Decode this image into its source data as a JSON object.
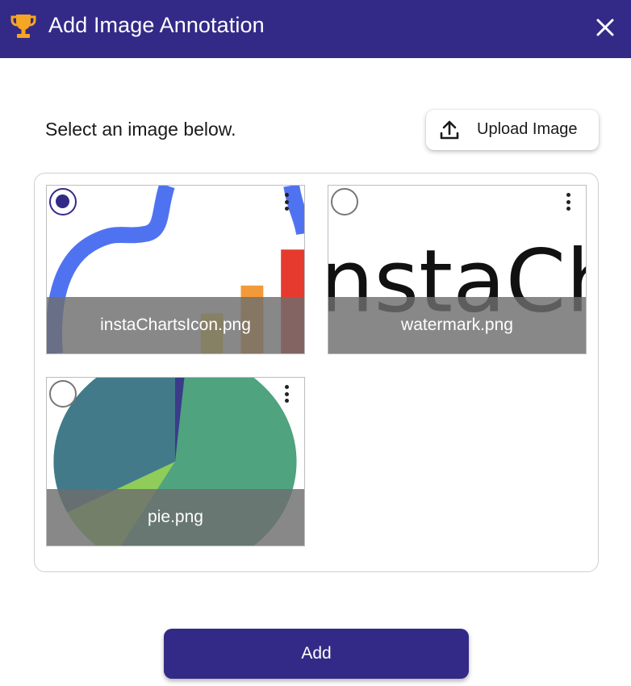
{
  "dialog": {
    "title": "Add Image Annotation",
    "title_icon": "trophy-icon",
    "close_icon": "close-icon",
    "header_color": "#332a87",
    "icon_color": "#f5a623"
  },
  "toolbar": {
    "prompt": "Select an image below.",
    "upload_label": "Upload Image",
    "upload_icon": "upload-icon"
  },
  "images": [
    {
      "filename": "instaChartsIcon.png",
      "selected": true,
      "menu_icon": "more-vert-icon"
    },
    {
      "filename": "watermark.png",
      "selected": false,
      "menu_icon": "more-vert-icon"
    },
    {
      "filename": "pie.png",
      "selected": false,
      "menu_icon": "more-vert-icon"
    }
  ],
  "footer": {
    "add_label": "Add"
  }
}
